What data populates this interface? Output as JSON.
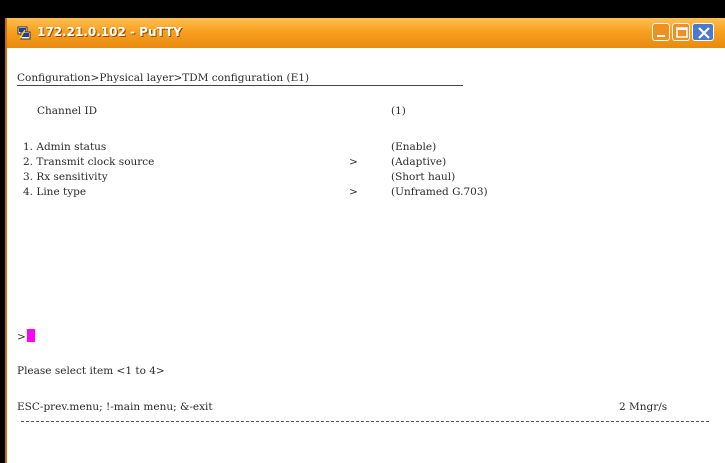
{
  "window": {
    "title": "172.21.0.102 - PuTTY",
    "icon": "putty-icon",
    "controls": [
      "minimize-icon",
      "maximize-icon",
      "close-icon"
    ],
    "colors": {
      "titlebar": "#f8a020",
      "close": "#4a7ad0",
      "cursor": "#ff00ff"
    }
  },
  "terminal": {
    "breadcrumb": "Configuration>Physical layer>TDM configuration (E1)",
    "channel": {
      "label": "Channel ID",
      "value": "(1)"
    },
    "items": [
      {
        "label": "1. Admin status",
        "arrow": "",
        "value": "(Enable)"
      },
      {
        "label": "2. Transmit clock source",
        "arrow": ">",
        "value": "(Adaptive)"
      },
      {
        "label": "3. Rx sensitivity",
        "arrow": "",
        "value": "(Short haul)"
      },
      {
        "label": "4. Line type",
        "arrow": ">",
        "value": "(Unframed G.703)"
      }
    ],
    "prompt_symbol": ">",
    "select_prompt": "Please select item <1 to 4>",
    "help_line": "ESC-prev.menu; !-main menu; &-exit",
    "status_right": "2 Mngr/s"
  }
}
